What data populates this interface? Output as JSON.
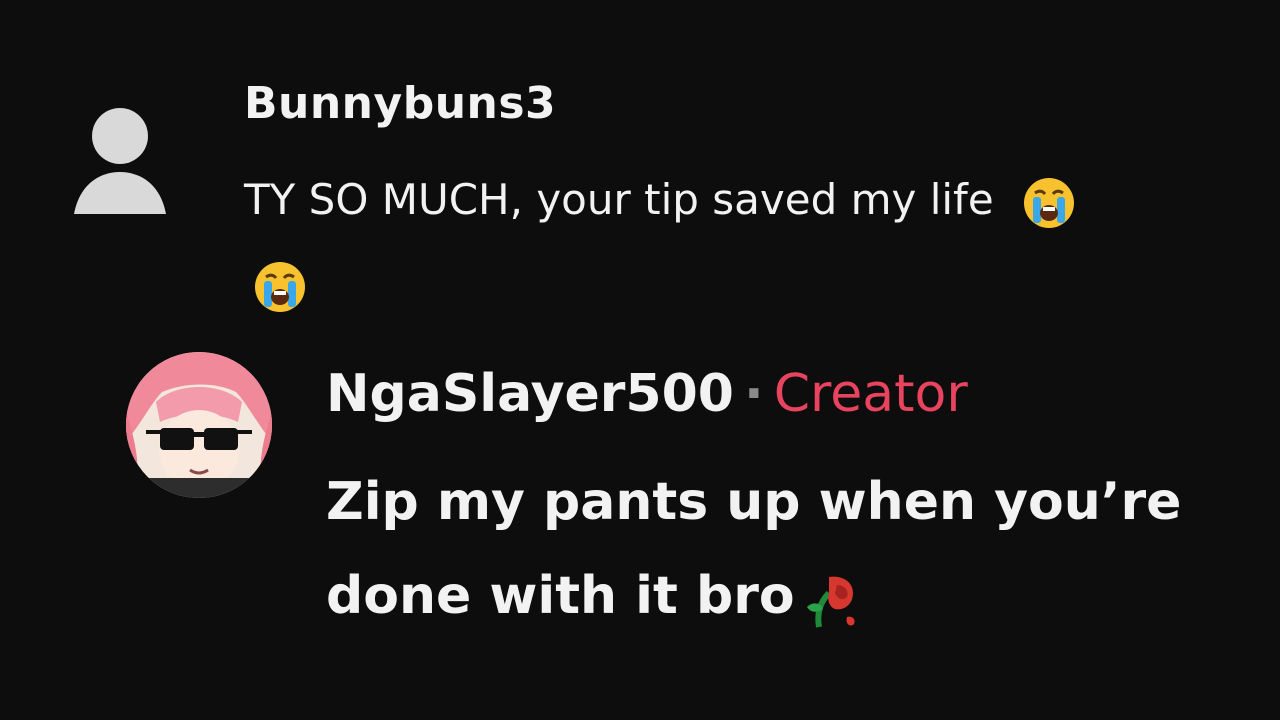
{
  "comments": [
    {
      "username": "Bunnybuns3",
      "text": "TY SO MUCH, your tip saved my life",
      "emojis": [
        "loudly-crying-face",
        "loudly-crying-face"
      ],
      "avatar": "default-user-silhouette"
    },
    {
      "username": "NgaSlayer500",
      "separator": "·",
      "badge": "Creator",
      "text_line1": "Zip my pants up when you’re",
      "text_line2": "done with it bro",
      "emojis": [
        "wilted-rose"
      ],
      "avatar": "anime-girl-sunglasses"
    }
  ],
  "colors": {
    "background": "#0d0d0d",
    "text": "#f2f2f2",
    "creator_badge": "#e8445f",
    "separator": "#8a8a8a",
    "default_avatar": "#d9d9d9"
  }
}
